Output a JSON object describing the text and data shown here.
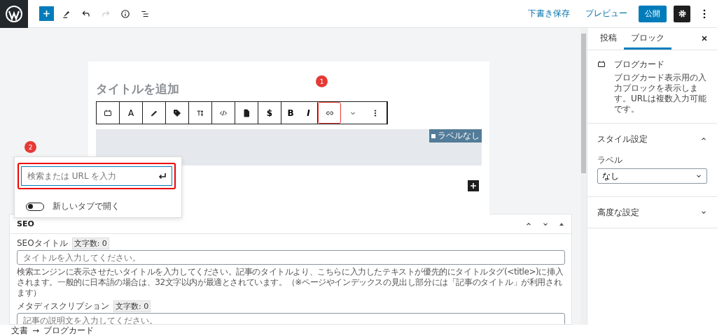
{
  "header": {
    "draft": "下書き保存",
    "preview": "プレビュー",
    "publish": "公開",
    "settings_on": true
  },
  "editor": {
    "title_placeholder": "タイトルを追加",
    "toolbar": [
      {
        "kind": "icon",
        "highlighted": false
      },
      {
        "kind": "text",
        "label": "A",
        "highlighted": false
      },
      {
        "kind": "icon",
        "highlighted": false
      },
      {
        "kind": "icon",
        "highlighted": false
      },
      {
        "kind": "icon",
        "highlighted": false
      },
      {
        "kind": "icon",
        "highlighted": false
      },
      {
        "kind": "icon",
        "highlighted": false
      },
      {
        "kind": "text",
        "label": "$",
        "highlighted": false
      },
      {
        "kind": "text",
        "label": "B",
        "highlighted": false
      },
      {
        "kind": "text",
        "label": "I",
        "highlighted": false
      },
      {
        "kind": "icon",
        "highlighted": true
      },
      {
        "kind": "icon",
        "highlighted": false
      },
      {
        "kind": "icon",
        "highlighted": false
      }
    ],
    "block_label": "ラベルなし",
    "link_popover": {
      "placeholder": "検索または URL を入力",
      "toggle_label": "新しいタブで開く",
      "toggle_on": false
    },
    "badges": [
      "1",
      "2"
    ]
  },
  "seo": {
    "title": "SEO",
    "fields": [
      {
        "label": "SEOタイトル",
        "count": "文字数: 0",
        "placeholder": "タイトルを入力してください。",
        "help": "検索エンジンに表示させたいタイトルを入力してください。記事のタイトルより、こちらに入力したテキストが優先的にタイトルタグ(<title>)に挿入されます。一般的に日本語の場合は、32文字以内が最適とされています。（※ページやインデックスの見出し部分には「記事のタイトル」が利用されます）"
      },
      {
        "label": "メタディスクリプション",
        "count": "文字数: 0",
        "placeholder": "記事の説明文を入力してください。"
      }
    ]
  },
  "sidebar": {
    "tabs": [
      {
        "label": "投稿",
        "selected": false
      },
      {
        "label": "ブロック",
        "selected": true
      }
    ],
    "block": {
      "name": "ブログカード",
      "description": "ブログカード表示用の入力ブロックを表示します。URLは複数入力可能です。"
    },
    "panels": [
      {
        "title": "スタイル設定",
        "expanded": true,
        "select_label": "ラベル",
        "select_value": "なし"
      },
      {
        "title": "高度な設定",
        "expanded": false
      }
    ]
  },
  "breadcrumb": {
    "items": [
      "文書",
      "ブログカード"
    ],
    "separator": "→"
  }
}
